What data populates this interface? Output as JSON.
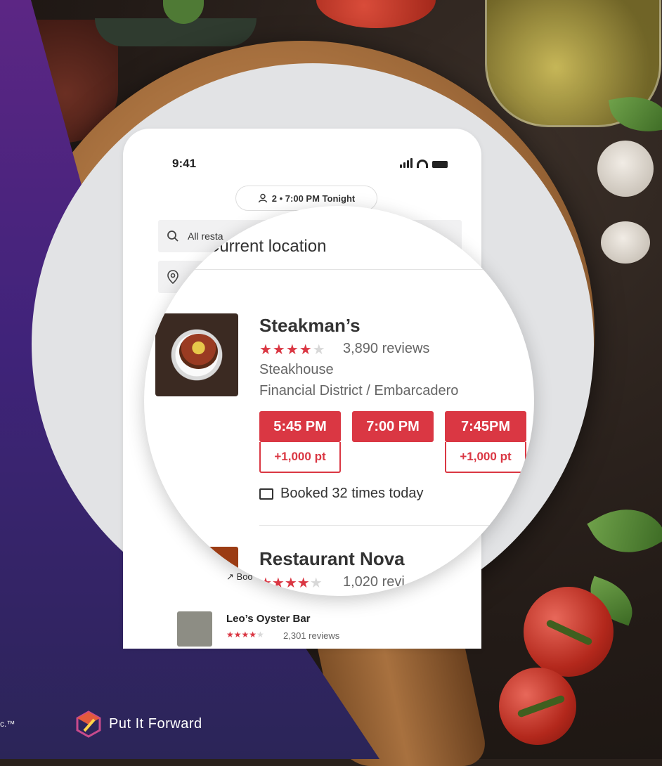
{
  "phone": {
    "time": "9:41",
    "party_time": "2 • 7:00 PM Tonight",
    "search_placeholder": "All resta",
    "location_text": "Current location"
  },
  "restaurants": [
    {
      "name": "Steakman’s",
      "rating": 4,
      "reviews": "3,890 reviews",
      "cuisine": "Steakhouse",
      "neighborhood": "Financial District / Embarcadero",
      "slots": [
        {
          "time": "5:45 PM",
          "points": "+1,000 pt"
        },
        {
          "time": "7:00 PM",
          "points": ""
        },
        {
          "time": "7:45PM",
          "points": "+1,000 pt"
        }
      ],
      "booked": "Booked 32 times today"
    },
    {
      "name": "Restaurant Nova",
      "rating": 4,
      "reviews": "1,020 revi",
      "booked_partial": "Boo"
    },
    {
      "name": "Leo’s Oyster Bar",
      "rating": 4,
      "reviews": "2,301 reviews"
    }
  ],
  "footer": {
    "left_text": "c.™",
    "brand": "Put It Forward"
  },
  "colors": {
    "accent": "#da3743",
    "overlay_top": "#5c2684",
    "overlay_bottom": "#2b2558"
  }
}
